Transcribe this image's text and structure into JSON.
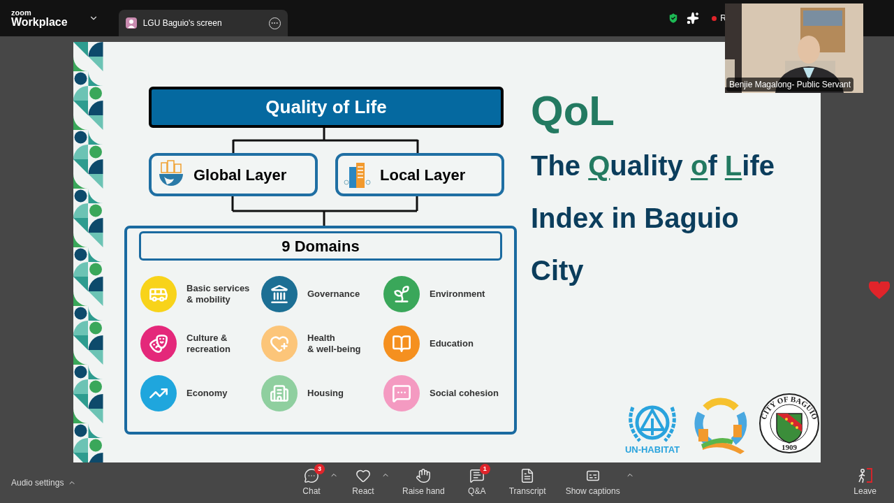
{
  "app": {
    "logo_top": "zoom",
    "logo_bottom": "Workplace"
  },
  "share_tab": {
    "title": "LGU Baguio's screen"
  },
  "recording": {
    "label": "R"
  },
  "slide": {
    "diagram": {
      "top": "Quality of Life",
      "layers": [
        "Global Layer",
        "Local Layer"
      ],
      "domains_title": "9 Domains",
      "domains": [
        {
          "label": "Basic services\n& mobility",
          "color": "#f8d31a"
        },
        {
          "label": "Governance",
          "color": "#1c6f94"
        },
        {
          "label": "Environment",
          "color": "#3aa75a"
        },
        {
          "label": "Culture &\nrecreation",
          "color": "#e4287a"
        },
        {
          "label": "Health\n& well-being",
          "color": "#fcc579"
        },
        {
          "label": "Education",
          "color": "#f5901f"
        },
        {
          "label": "Economy",
          "color": "#1fa6dd"
        },
        {
          "label": "Housing",
          "color": "#8fcf9f"
        },
        {
          "label": "Social cohesion",
          "color": "#f49ac1"
        }
      ]
    },
    "title": "QoL",
    "subtitle_lines": [
      [
        {
          "text": "The ",
          "accent": false
        },
        {
          "text": "Q",
          "accent": true
        },
        {
          "text": "uality ",
          "accent": false
        },
        {
          "text": "o",
          "accent": true
        },
        {
          "text": "f ",
          "accent": false
        },
        {
          "text": "L",
          "accent": true
        },
        {
          "text": "ife",
          "accent": false
        }
      ],
      [
        {
          "text": "Index in Baguio",
          "accent": false
        }
      ],
      [
        {
          "text": "City",
          "accent": false
        }
      ]
    ],
    "logos": {
      "unhabitat": "UN-HABITAT",
      "seal_ring": "CITY OF BAGUIO",
      "seal_year": "1909"
    }
  },
  "video": {
    "name": "Benjie Magalong- Public Servant"
  },
  "toolbar": {
    "audio": "Audio settings",
    "items": [
      {
        "label": "Chat",
        "badge": "3",
        "caret": true
      },
      {
        "label": "React",
        "caret": true
      },
      {
        "label": "Raise hand",
        "caret": false
      },
      {
        "label": "Q&A",
        "badge": "1",
        "caret": false
      },
      {
        "label": "Transcript",
        "caret": false
      },
      {
        "label": "Show captions",
        "caret": true
      }
    ],
    "leave": "Leave"
  }
}
